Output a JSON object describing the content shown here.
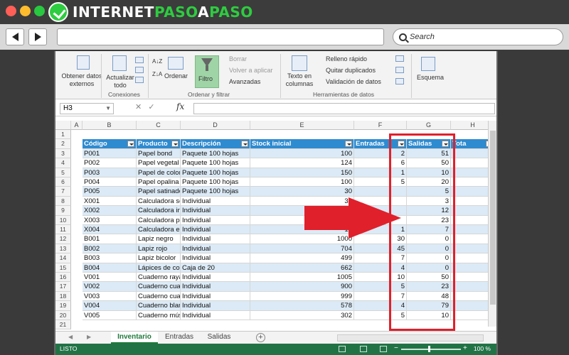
{
  "browser": {
    "logo": {
      "part1": "INTERNET",
      "part2": "PASO",
      "part3": "A",
      "part4": "PASO"
    },
    "search_placeholder": "Search"
  },
  "ribbon": {
    "obtener": "Obtener datos externos",
    "actualizar": "Actualizar todo",
    "conexiones": "Conexiones",
    "ordenar": "Ordenar",
    "filtro": "Filtro",
    "borrar": "Borrar",
    "volver": "Volver a aplicar",
    "avanzadas": "Avanzadas",
    "ordenar_filtrar": "Ordenar y filtrar",
    "texto_columnas": "Texto en columnas",
    "relleno": "Relleno rápido",
    "quitar": "Quitar duplicados",
    "validacion": "Validación de datos",
    "herramientas": "Herramientas de datos",
    "esquema": "Esquema"
  },
  "formula_bar": {
    "name_box": "H3",
    "fx": "fx",
    "value": ""
  },
  "columns": [
    "A",
    "B",
    "C",
    "D",
    "E",
    "F",
    "G",
    "H"
  ],
  "table": {
    "headers": [
      "Código",
      "Producto",
      "Descripción",
      "Stock inicial",
      "Entradas",
      "Salidas",
      "Tota"
    ],
    "rows": [
      [
        "P001",
        "Papel bond",
        "Paquete 100 hojas",
        "100",
        "2",
        "51"
      ],
      [
        "P002",
        "Papel vegetal",
        "Paquete 100 hojas",
        "124",
        "6",
        "50"
      ],
      [
        "P003",
        "Papel de colores",
        "Paquete 100 hojas",
        "150",
        "1",
        "10"
      ],
      [
        "P004",
        "Papel opalina",
        "Paquete 100 hojas",
        "100",
        "5",
        "20"
      ],
      [
        "P005",
        "Papel satinado",
        "Paquete 100 hojas",
        "30",
        "",
        "5"
      ],
      [
        "X001",
        "Calculadora sencilla",
        "Individual",
        "30",
        "",
        "3"
      ],
      [
        "X002",
        "Calculadora infantil",
        "Individual",
        "",
        "",
        "12"
      ],
      [
        "X003",
        "Calculadora profesional",
        "Individual",
        "",
        "",
        "23"
      ],
      [
        "X004",
        "Calculadora especial",
        "Individual",
        "10",
        "1",
        "7"
      ],
      [
        "B001",
        "Lapiz negro",
        "Individual",
        "1000",
        "30",
        "0"
      ],
      [
        "B002",
        "Lapiz rojo",
        "Individual",
        "704",
        "45",
        "0"
      ],
      [
        "B003",
        "Lapiz bicolor",
        "Individual",
        "499",
        "7",
        "0"
      ],
      [
        "B004",
        "Lápices de colores",
        "Caja de 20",
        "662",
        "4",
        "0"
      ],
      [
        "V001",
        "Cuaderno rayas",
        "Individual",
        "1005",
        "10",
        "50"
      ],
      [
        "V002",
        "Cuaderno cuadro grande",
        "Individual",
        "900",
        "5",
        "23"
      ],
      [
        "V003",
        "Cuaderno cuadro chico",
        "Individual",
        "999",
        "7",
        "48"
      ],
      [
        "V004",
        "Cuaderno blanco",
        "Individual",
        "578",
        "4",
        "79"
      ],
      [
        "V005",
        "Cuaderno música",
        "Individual",
        "302",
        "5",
        "10"
      ]
    ]
  },
  "sheets": [
    "Inventario",
    "Entradas",
    "Salidas"
  ],
  "active_sheet": "Inventario",
  "status": {
    "mode": "LISTO",
    "zoom": "100 %"
  },
  "colors": {
    "header_blue": "#2e8bd0",
    "band_blue": "#dbeaf6",
    "excel_green": "#217346",
    "annotation_red": "#e0202b"
  }
}
